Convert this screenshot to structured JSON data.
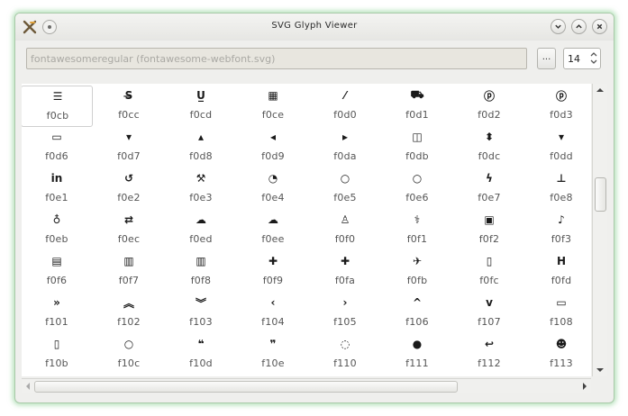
{
  "window": {
    "title": "SVG Glyph Viewer"
  },
  "toolbar": {
    "font_path": "fontawesomeregular (fontawesome-webfont.svg)",
    "browse_label": "...",
    "size_value": "14"
  },
  "glyphs": [
    {
      "code": "f0cb",
      "icon": "list-ol-icon",
      "sym": "☰"
    },
    {
      "code": "f0cc",
      "icon": "strikethrough-icon",
      "sym": "S̶"
    },
    {
      "code": "f0cd",
      "icon": "underline-icon",
      "sym": "U̲"
    },
    {
      "code": "f0ce",
      "icon": "table-icon",
      "sym": "▦"
    },
    {
      "code": "f0d0",
      "icon": "magic-wand-icon",
      "sym": "⁄"
    },
    {
      "code": "f0d1",
      "icon": "truck-icon",
      "sym": "⛟"
    },
    {
      "code": "f0d2",
      "icon": "pinterest-icon",
      "sym": "ⓟ"
    },
    {
      "code": "f0d3",
      "icon": "pinterest-square-icon",
      "sym": "ⓟ"
    },
    {
      "code": "f0d6",
      "icon": "money-icon",
      "sym": "▭"
    },
    {
      "code": "f0d7",
      "icon": "caret-down-icon",
      "sym": "▾"
    },
    {
      "code": "f0d8",
      "icon": "caret-up-icon",
      "sym": "▴"
    },
    {
      "code": "f0d9",
      "icon": "caret-left-icon",
      "sym": "◂"
    },
    {
      "code": "f0da",
      "icon": "caret-right-icon",
      "sym": "▸"
    },
    {
      "code": "f0db",
      "icon": "columns-icon",
      "sym": "◫"
    },
    {
      "code": "f0dc",
      "icon": "sort-icon",
      "sym": "⬍"
    },
    {
      "code": "f0dd",
      "icon": "sort-down-icon",
      "sym": "▾"
    },
    {
      "code": "f0e1",
      "icon": "linkedin-icon",
      "sym": "in"
    },
    {
      "code": "f0e2",
      "icon": "undo-icon",
      "sym": "↺"
    },
    {
      "code": "f0e3",
      "icon": "gavel-icon",
      "sym": "⚒"
    },
    {
      "code": "f0e4",
      "icon": "dashboard-icon",
      "sym": "◔"
    },
    {
      "code": "f0e5",
      "icon": "comment-o-icon",
      "sym": "○"
    },
    {
      "code": "f0e6",
      "icon": "comments-o-icon",
      "sym": "○"
    },
    {
      "code": "f0e7",
      "icon": "bolt-icon",
      "sym": "ϟ"
    },
    {
      "code": "f0e8",
      "icon": "sitemap-icon",
      "sym": "⊥"
    },
    {
      "code": "f0eb",
      "icon": "lightbulb-icon",
      "sym": "♁"
    },
    {
      "code": "f0ec",
      "icon": "exchange-icon",
      "sym": "⇄"
    },
    {
      "code": "f0ed",
      "icon": "cloud-download-icon",
      "sym": "☁"
    },
    {
      "code": "f0ee",
      "icon": "cloud-upload-icon",
      "sym": "☁"
    },
    {
      "code": "f0f0",
      "icon": "user-md-icon",
      "sym": "♙"
    },
    {
      "code": "f0f1",
      "icon": "stethoscope-icon",
      "sym": "⚕"
    },
    {
      "code": "f0f2",
      "icon": "suitcase-icon",
      "sym": "▣"
    },
    {
      "code": "f0f3",
      "icon": "bell-icon",
      "sym": "♪"
    },
    {
      "code": "f0f6",
      "icon": "file-text-o-icon",
      "sym": "▤"
    },
    {
      "code": "f0f7",
      "icon": "building-icon",
      "sym": "▥"
    },
    {
      "code": "f0f8",
      "icon": "hospital-icon",
      "sym": "▥"
    },
    {
      "code": "f0f9",
      "icon": "ambulance-icon",
      "sym": "✚"
    },
    {
      "code": "f0fa",
      "icon": "medkit-icon",
      "sym": "✚"
    },
    {
      "code": "f0fb",
      "icon": "fighter-jet-icon",
      "sym": "✈"
    },
    {
      "code": "f0fc",
      "icon": "beer-icon",
      "sym": "▯"
    },
    {
      "code": "f0fd",
      "icon": "h-square-icon",
      "sym": "H"
    },
    {
      "code": "f101",
      "icon": "angle-double-right-icon",
      "sym": "»"
    },
    {
      "code": "f102",
      "icon": "angle-double-up-icon",
      "sym": "︽"
    },
    {
      "code": "f103",
      "icon": "angle-double-down-icon",
      "sym": "︾"
    },
    {
      "code": "f104",
      "icon": "angle-left-icon",
      "sym": "‹"
    },
    {
      "code": "f105",
      "icon": "angle-right-icon",
      "sym": "›"
    },
    {
      "code": "f106",
      "icon": "angle-up-icon",
      "sym": "^"
    },
    {
      "code": "f107",
      "icon": "angle-down-icon",
      "sym": "v"
    },
    {
      "code": "f108",
      "icon": "desktop-icon",
      "sym": "▭"
    },
    {
      "code": "f10b",
      "icon": "mobile-icon",
      "sym": "▯"
    },
    {
      "code": "f10c",
      "icon": "circle-o-icon",
      "sym": "○"
    },
    {
      "code": "f10d",
      "icon": "quote-left-icon",
      "sym": "❝"
    },
    {
      "code": "f10e",
      "icon": "quote-right-icon",
      "sym": "❞"
    },
    {
      "code": "f110",
      "icon": "spinner-icon",
      "sym": "◌"
    },
    {
      "code": "f111",
      "icon": "circle-icon",
      "sym": "●"
    },
    {
      "code": "f112",
      "icon": "reply-icon",
      "sym": "↩"
    },
    {
      "code": "f113",
      "icon": "github-alt-icon",
      "sym": "☻"
    }
  ],
  "colors": {
    "glyph": "#1a1a1a",
    "code_text": "#555555",
    "window_glow": "#7cc88a"
  }
}
